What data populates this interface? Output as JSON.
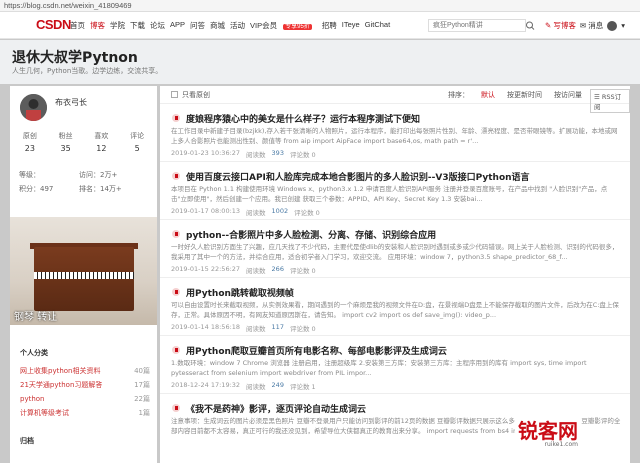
{
  "url": "https://blog.csdn.net/weixin_41809469",
  "nav": {
    "logo": "CSDN",
    "links": [
      "首页",
      "博客",
      "学院",
      "下载",
      "论坛",
      "APP",
      "问答",
      "商城",
      "活动",
      "VIP会员",
      "招聘",
      "ITeye",
      "GitChat"
    ],
    "vip_badge": "专享95折",
    "search_placeholder": "疯狂Python精讲",
    "write": "写博客",
    "messages": "消息"
  },
  "blog": {
    "title": "退休大叔学Pytnon",
    "subtitle": "人生几何，Python当歌。边学边练，交流共享。"
  },
  "profile": {
    "name": "布衣弓长",
    "stats": [
      {
        "label": "原创",
        "value": "23"
      },
      {
        "label": "粉丝",
        "value": "35"
      },
      {
        "label": "喜欢",
        "value": "12"
      },
      {
        "label": "评论",
        "value": "5"
      }
    ],
    "level_label": "等级：",
    "visits": "访问：2万+",
    "points": "积分：497",
    "rank": "排名：14万+",
    "image_caption": "钢琴 转让"
  },
  "categories": {
    "title": "个人分类",
    "items": [
      {
        "name": "网上收集python相关资料",
        "count": "40篇"
      },
      {
        "name": "21天学通python习题解答",
        "count": "17篇"
      },
      {
        "name": "python",
        "count": "22篇"
      },
      {
        "name": "计算机等级考试",
        "count": "1篇"
      }
    ],
    "archive_title": "归档"
  },
  "filter": {
    "only_original": "只看原创",
    "sort_label": "排序：",
    "sort_default": "默认",
    "sort_update": "按更新时间",
    "sort_visits": "按访问量",
    "rss": "RSS订阅"
  },
  "articles": [
    {
      "title": "度娘程序猿心中的美女是什么样子？运行本程序测试下便知",
      "summary": "在工作目录中新建子目录(bzjkk),存入若干张清晰的人物照片，运行本程序，能打印出每张照片性别、年龄、漂亮程度、是否带眼镜等。扩展功能，本地或网上多人合影照片也能测出性别、颜值等 from aip import AipFace import base64,os, math path = r'...",
      "date": "2019-01-23 10:36:27",
      "views_label": "阅读数",
      "views": "393",
      "comments": "评论数 0"
    },
    {
      "title": "使用百度云接口API和人脸库完成本地合影图片的多人脸识别--V3版接口Python语言",
      "summary": "本项目在 Python 1.1 构建使用环境 Windows x、python3.x 1.2 申请百度人脸识别API服务 注册并登录百度账号，在产品中找到 \"人脸识别\"产品，点击\"立即使用\"，然后创建一个应用。我已创建 获取三个参数：APPID、API Key、Secret Key 1.3 安装bai...",
      "date": "2019-01-17 08:00:13",
      "views_label": "阅读数",
      "views": "1002",
      "comments": "评论数 0"
    },
    {
      "title": "python--合影照片中多人脸检测、分离、存储、识别综合应用",
      "summary": "一时好久人脸识别方面生了兴趣，应几天找了不少代码，主要代是使dlib的安装和人脸识别时遇到或多或少代码错误。网上关于人脸检测、识别的代码很多，我采用了其中一个的方法，并综合应用，适合初学者入门学习，欢迎交流。 应用环境：window 7，python3.5 shape_predictor_68_f...",
      "date": "2019-01-15 22:56:27",
      "views_label": "阅读数",
      "views": "266",
      "comments": "评论数 0"
    },
    {
      "title": "用Python跳转截取视频帧",
      "summary": "可以自由设置时长来截取视频，从实例效果看，期间遇到的一个麻烦是我的视频文件在D:盘，在景视端D盘是上不能保存截取的图片文件，后改为在C:盘上保存，正常。具体原因不明，有网友知道原因斯在，请告知。 import cv2 import os def save_img(): video_p...",
      "date": "2019-01-14 18:56:18",
      "views_label": "阅读数",
      "views": "117",
      "comments": "评论数 0"
    },
    {
      "title": "用Python爬取豆瓣首页所有电影名称、每部电影影评及生成词云",
      "summary": "1.数取环境：window 7 Chrome 浏览器 注册启用，注册超级库 2.安装第三方库：安装第三方库：主程序用到的库有 import sys, time import pytesseract from selenium import webdriver from PIL impor...",
      "date": "2018-12-24 17:19:32",
      "views_label": "阅读数",
      "views": "249",
      "comments": "评论数 1"
    },
    {
      "title": "《我不是药神》影评，逐页评论自动生成词云",
      "summary": "注意事项：生成词云的图片必须是黑色照片 豆瓣不登录用户只能访问到影评的前12页的数据 豆瓣影评数据只展示这么多 电影为例 数据不全 ... 豆瓣影评的全部内容目前都不太容易，真正可行的我还没见到，希望导位大侠都真正的教育出来分享。 import requests from bs4 impor...",
      "date": "",
      "views_label": "",
      "views": "",
      "comments": ""
    }
  ],
  "watermark": {
    "text": "锐客网",
    "sub": "ruike1.com"
  }
}
